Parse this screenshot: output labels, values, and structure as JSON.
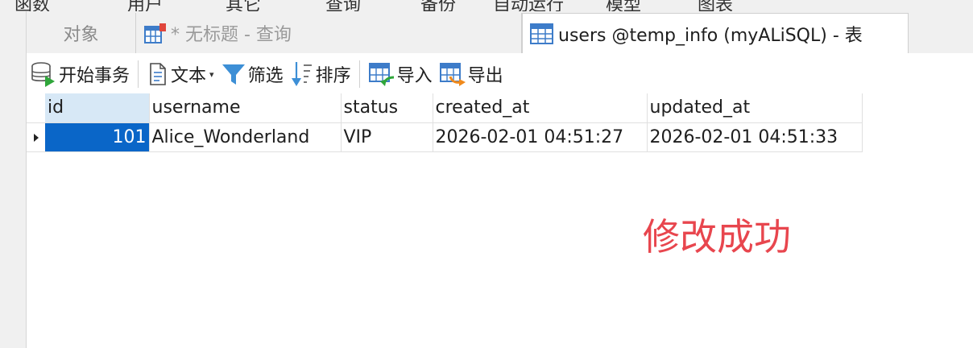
{
  "menu": {
    "items": [
      "函数",
      "用户",
      "其它",
      "查询",
      "备份",
      "自动运行",
      "模型",
      "图表"
    ]
  },
  "tabs": {
    "objects": "对象",
    "query": "* 无标题 - 查询",
    "active": "users @temp_info (myALiSQL) - 表"
  },
  "toolbar": {
    "begin_transaction": "开始事务",
    "text": "文本",
    "filter": "筛选",
    "sort": "排序",
    "import": "导入",
    "export": "导出"
  },
  "table": {
    "columns": [
      "id",
      "username",
      "status",
      "created_at",
      "updated_at"
    ],
    "rows": [
      [
        "101",
        "Alice_Wonderland",
        "VIP",
        "2026-02-01 04:51:27",
        "2026-02-01 04:51:33"
      ]
    ]
  },
  "annotation": "修改成功",
  "colors": {
    "selection": "#0a66c8",
    "header_selected": "#d7e8f6",
    "annotation": "#e8464e"
  }
}
